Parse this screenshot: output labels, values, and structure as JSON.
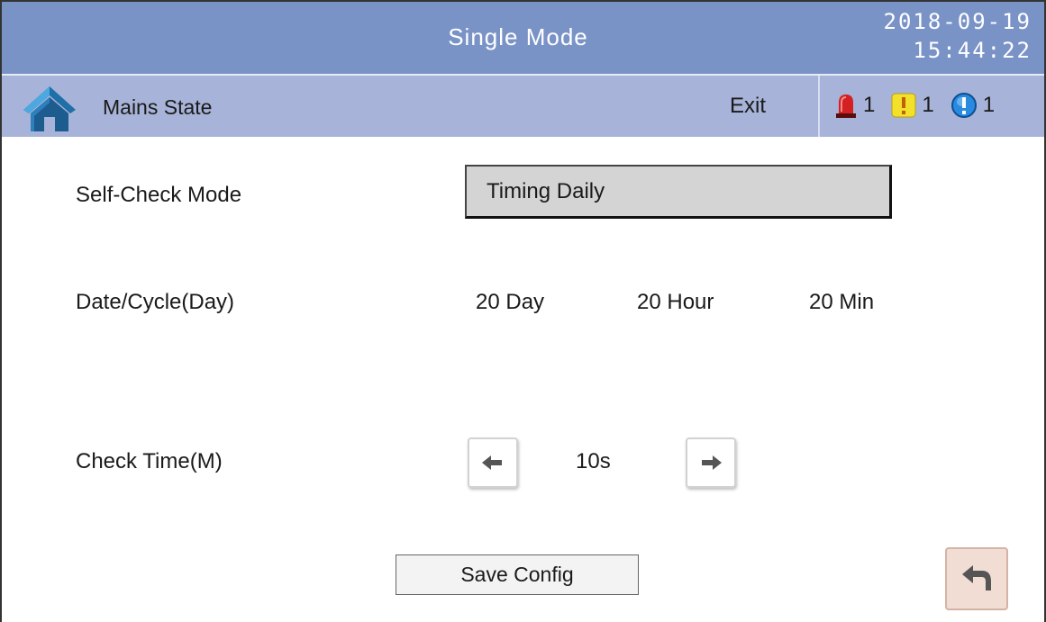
{
  "header": {
    "title": "Single Mode",
    "date": "2018-09-19",
    "time": "15:44:22"
  },
  "subheader": {
    "home_icon": "home-icon",
    "title": "Mains State",
    "exit_label": "Exit",
    "alarms": [
      {
        "icon": "siren-icon",
        "count": "1",
        "color": "#d42020"
      },
      {
        "icon": "warning-icon",
        "count": "1",
        "color": "#f2e02a"
      },
      {
        "icon": "info-icon",
        "count": "1",
        "color": "#2a8ae0"
      }
    ]
  },
  "settings": {
    "self_check": {
      "label": "Self-Check Mode",
      "value": "Timing Daily"
    },
    "date_cycle": {
      "label": "Date/Cycle(Day)",
      "day": "20 Day",
      "hour": "20 Hour",
      "min": "20 Min"
    },
    "check_time": {
      "label": "Check Time(M)",
      "value": "10s",
      "dec_icon": "arrow-left-icon",
      "inc_icon": "arrow-right-icon"
    }
  },
  "footer": {
    "save_label": "Save Config",
    "back_icon": "return-icon"
  },
  "colors": {
    "title_bar": "#7a93c7",
    "sub_bar": "#a7b3d8",
    "mode_box": "#d4d4d4",
    "back_button": "#f2ddd4"
  }
}
